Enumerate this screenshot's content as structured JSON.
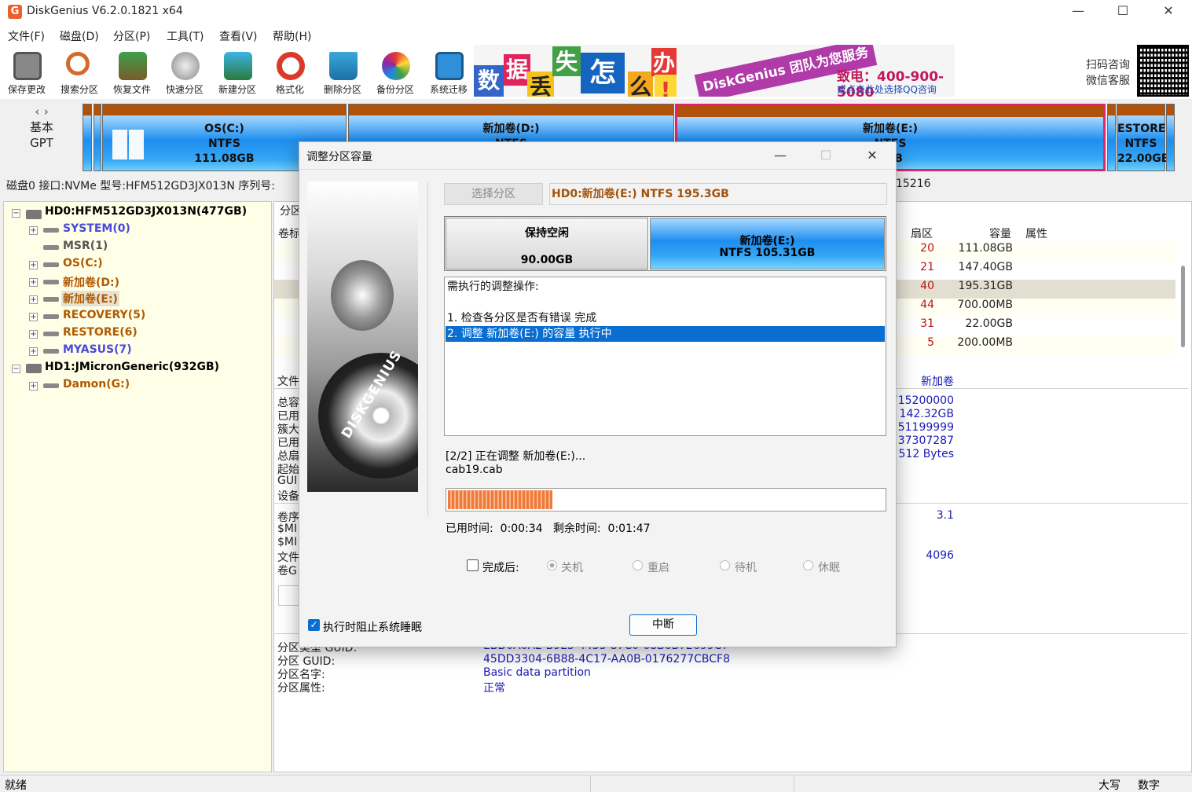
{
  "window": {
    "title": "DiskGenius V6.2.0.1821 x64",
    "minimize": "—",
    "maximize": "☐",
    "close": "✕",
    "app_icon": "G"
  },
  "menu": [
    "文件(F)",
    "磁盘(D)",
    "分区(P)",
    "工具(T)",
    "查看(V)",
    "帮助(H)"
  ],
  "toolbar": [
    "保存更改",
    "搜索分区",
    "恢复文件",
    "快速分区",
    "新建分区",
    "格式化",
    "删除分区",
    "备份分区",
    "系统迁移"
  ],
  "banner": {
    "words": [
      "数",
      "据",
      "丢",
      "失",
      "怎",
      "么",
      "办",
      "!"
    ],
    "slogan": "DiskGenius 团队为您服务",
    "phone": "致电：400-900-5080",
    "qq": "或点击此处选择QQ咨询"
  },
  "qr": {
    "line1": "扫码咨询",
    "line2": "微信客服"
  },
  "disk_map": {
    "nav": "‹ ›",
    "basic": "基本",
    "gpt": "GPT",
    "partitions": [
      {
        "name": "OS(C:)",
        "fs": "NTFS",
        "size": "111.08GB"
      },
      {
        "name": "新加卷(D:)",
        "fs": "NTFS",
        "size": ""
      },
      {
        "name": "新加卷(E:)",
        "fs": "NTFS",
        "size": "1GB"
      },
      {
        "name": "ESTORE(",
        "fs": "NTFS",
        "size": "22.00GB"
      }
    ]
  },
  "disk_info": {
    "left": "磁盘0 接口:NVMe  型号:HFM512GD3JX013N  序列号:",
    "right": "15216"
  },
  "tree": {
    "disk0": "HD0:HFM512GD3JX013N(477GB)",
    "disk0_parts": [
      "SYSTEM(0)",
      "MSR(1)",
      "OS(C:)",
      "新加卷(D:)",
      "新加卷(E:)",
      "RECOVERY(5)",
      "RESTORE(6)",
      "MYASUS(7)"
    ],
    "disk1": "HD1:JMicronGeneric(932GB)",
    "disk1_parts": [
      "Damon(G:)"
    ]
  },
  "right_panel": {
    "tab_label": "分区",
    "vol_label": "卷标",
    "headers": {
      "sector": "扇区",
      "capacity": "容量",
      "attr": "属性"
    },
    "rows": [
      {
        "sector": "20",
        "capacity": "111.08GB"
      },
      {
        "sector": "21",
        "capacity": "147.40GB"
      },
      {
        "sector": "40",
        "capacity": "195.31GB"
      },
      {
        "sector": "44",
        "capacity": "700.00MB"
      },
      {
        "sector": "31",
        "capacity": "22.00GB"
      },
      {
        "sector": "5",
        "capacity": "200.00MB"
      }
    ],
    "fs_label": "文件",
    "fs_value": "新加卷",
    "left_labels": [
      "总容",
      "已用",
      "簇大",
      "已用",
      "总扇",
      "起始",
      "GUI",
      "设备"
    ],
    "values": [
      "715200000",
      "142.32GB",
      "51199999",
      "37307287",
      "512 Bytes"
    ],
    "left_labels2": [
      "卷序",
      "$MI",
      "$MI",
      "文件",
      "卷G"
    ],
    "values2": [
      "3.1",
      "4096"
    ],
    "part_info": [
      {
        "label": "分区类型 GUID:",
        "value": "EBD0A0A2-B9E5-4433-87C0-68B6B72699C7"
      },
      {
        "label": "分区 GUID:",
        "value": "45DD3304-6B88-4C17-AA0B-0176277CBCF8"
      },
      {
        "label": "分区名字:",
        "value": "Basic data partition"
      },
      {
        "label": "分区属性:",
        "value": "正常"
      }
    ]
  },
  "dialog": {
    "title": "调整分区容量",
    "minimize": "—",
    "maximize": "☐",
    "close": "✕",
    "select_btn": "选择分区",
    "selected": "HD0:新加卷(E:) NTFS 195.3GB",
    "free": {
      "label": "保持空闲",
      "size": "90.00GB"
    },
    "volume": {
      "label": "新加卷(E:)",
      "detail": "NTFS 105.31GB"
    },
    "ops_title": "需执行的调整操作:",
    "ops": [
      "1. 检查各分区是否有错误    完成",
      "2. 调整 新加卷(E:) 的容量    执行中"
    ],
    "status1": "[2/2] 正在调整 新加卷(E:)...",
    "status2": "cab19.cab",
    "progress": 0.24,
    "elapsed": "已用时间:  0:00:34   剩余时间:  0:01:47",
    "after_label": "完成后:",
    "after_options": [
      "关机",
      "重启",
      "待机",
      "休眠"
    ],
    "prevent_sleep": "执行时阻止系统睡眠",
    "abort": "中断",
    "image_brand": "DISKGENIUS"
  },
  "status": {
    "left": "就绪",
    "caps": "大写",
    "num": "数字"
  }
}
